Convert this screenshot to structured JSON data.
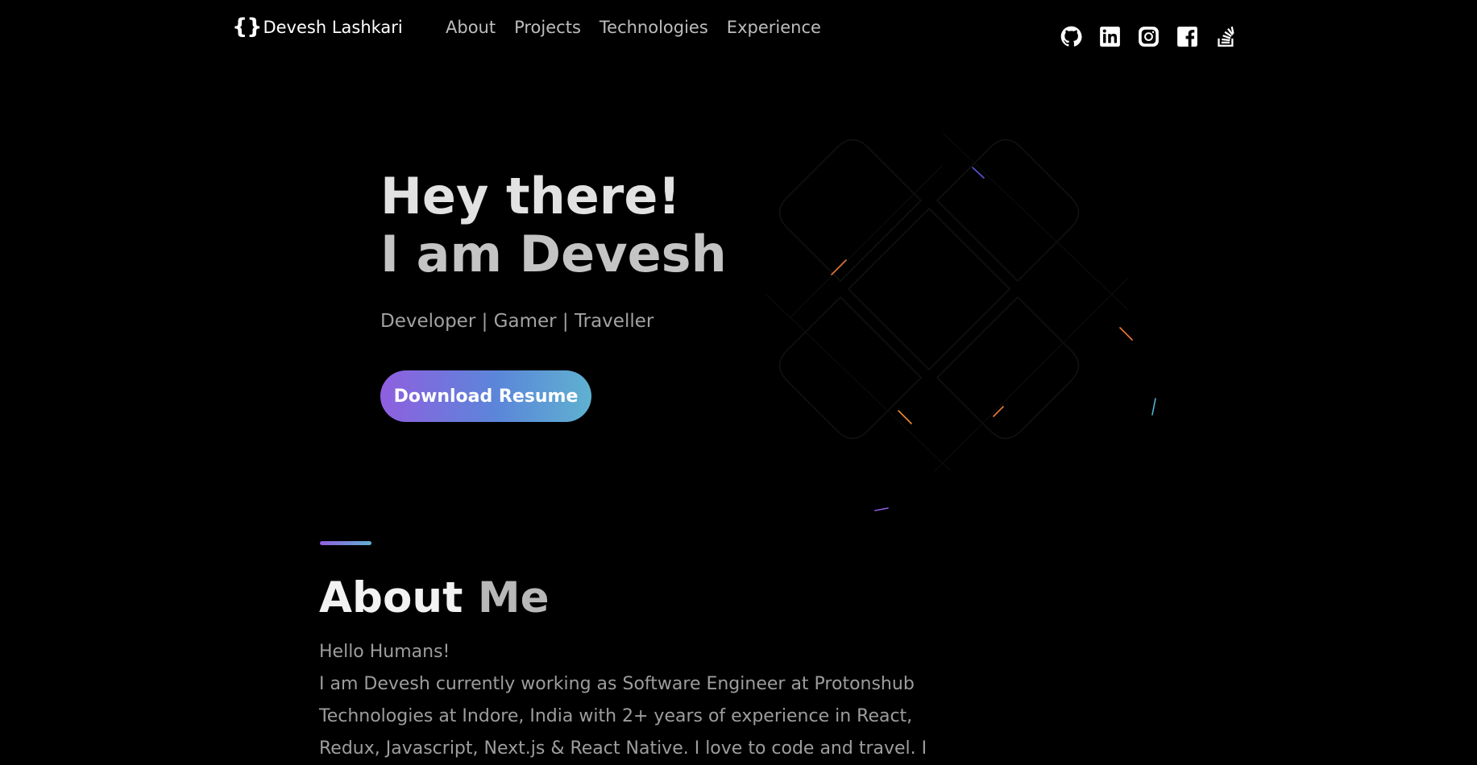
{
  "brand": {
    "icon_text": "{}",
    "name": "Devesh Lashkari"
  },
  "nav": {
    "items": [
      "About",
      "Projects",
      "Technologies",
      "Experience"
    ]
  },
  "socials": [
    "github-icon",
    "linkedin-icon",
    "instagram-icon",
    "facebook-icon",
    "stackoverflow-icon"
  ],
  "hero": {
    "line1": "Hey there!",
    "line2": "I am Devesh",
    "subtitle": "Developer | Gamer | Traveller",
    "button_label": "Download Resume"
  },
  "about": {
    "title_word1": "About",
    "title_word2": "Me",
    "greeting": "Hello Humans!",
    "line1": "I am Devesh currently working as Software Engineer at Protonshub",
    "line2": "Technologies at Indore, India with 2+ years of experience in React,",
    "line3": "Redux, Javascript, Next.js & React Native. I love to code and travel. I"
  },
  "colors": {
    "background": "#000000",
    "accent_start": "#8f5fe0",
    "accent_end": "#5fb1d1"
  }
}
